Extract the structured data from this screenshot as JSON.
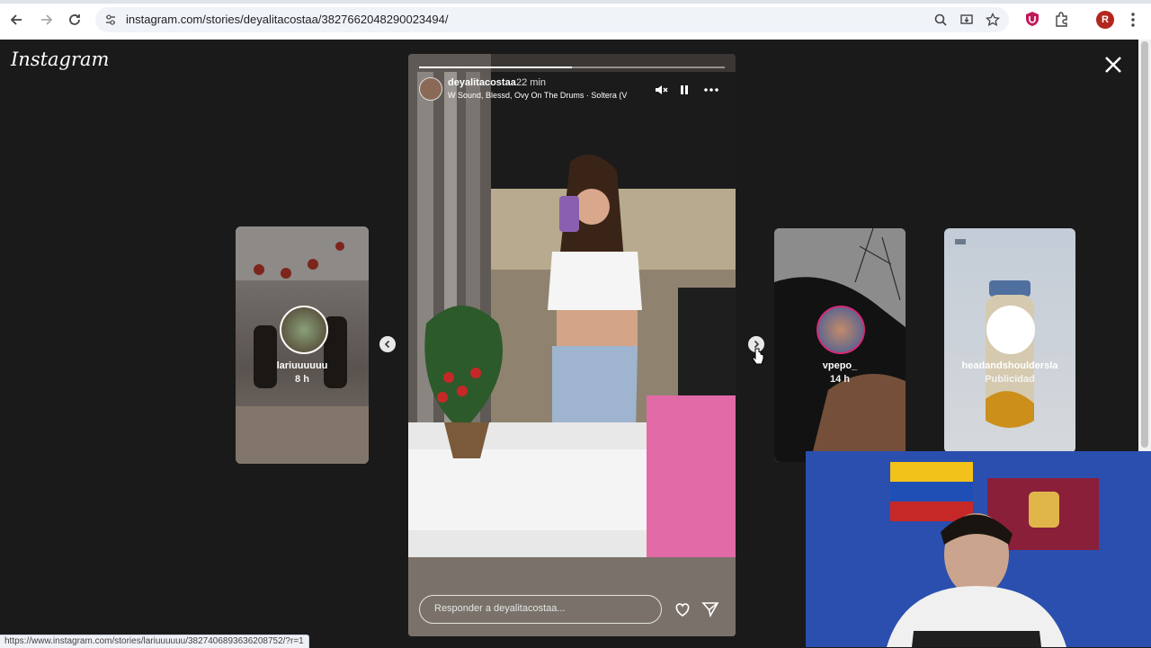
{
  "browser": {
    "url": "instagram.com/stories/deyalitacostaa/3827662048290023494/",
    "profile_initial": "R"
  },
  "viewer": {
    "logo": "Instagram"
  },
  "story": {
    "username": "deyalitacostaa",
    "time": "22 min",
    "song": "W Sound, Blessd, Ovy On The Drums · Soltera (V",
    "reply_placeholder": "Responder a deyalitacostaa...",
    "progress": 0.5
  },
  "side_cards": [
    {
      "username": "lariuuuuuu",
      "meta": "8 h"
    },
    {
      "username": "vpepo_",
      "meta": "14 h"
    },
    {
      "username": "headandshouldersla",
      "meta": "Publicidad"
    }
  ],
  "status_url": "https://www.instagram.com/stories/lariuuuuuu/3827406893636208752/?r=1",
  "colors": {
    "viewer_bg": "#1a1a1a",
    "accent_story_ring": "#d62976"
  }
}
